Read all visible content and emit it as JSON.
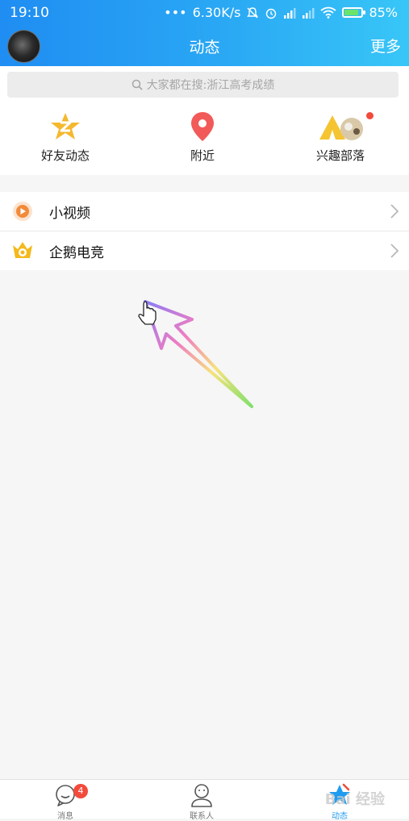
{
  "status_bar": {
    "time": "19:10",
    "net_speed": "6.30K/s",
    "battery": "85%",
    "battery_level": 0.85
  },
  "nav": {
    "title": "动态",
    "more": "更多"
  },
  "search": {
    "placeholder": "大家都在搜:浙江高考成绩"
  },
  "quick_entries": [
    {
      "label": "好友动态",
      "icon": "qzone-star-icon",
      "color": "#f5b82e"
    },
    {
      "label": "附近",
      "icon": "location-pin-icon",
      "color": "#f25a5a"
    },
    {
      "label": "兴趣部落",
      "icon": "tribe-tent-icon",
      "color": "#f5c431"
    }
  ],
  "list": [
    {
      "label": "小视频",
      "icon": "video-play-icon",
      "color": "#f28a3a"
    },
    {
      "label": "企鹅电竞",
      "icon": "esports-crown-icon",
      "color": "#f4b91c"
    }
  ],
  "tabs": [
    {
      "label": "消息",
      "badge": "4"
    },
    {
      "label": "联系人"
    },
    {
      "label": "动态",
      "active": true
    }
  ],
  "watermark": "Bai 经验",
  "colors": {
    "header_start": "#1f8df2",
    "header_end": "#38c6f7",
    "accent": "#1f9cf0",
    "badge": "#f24a3c"
  }
}
